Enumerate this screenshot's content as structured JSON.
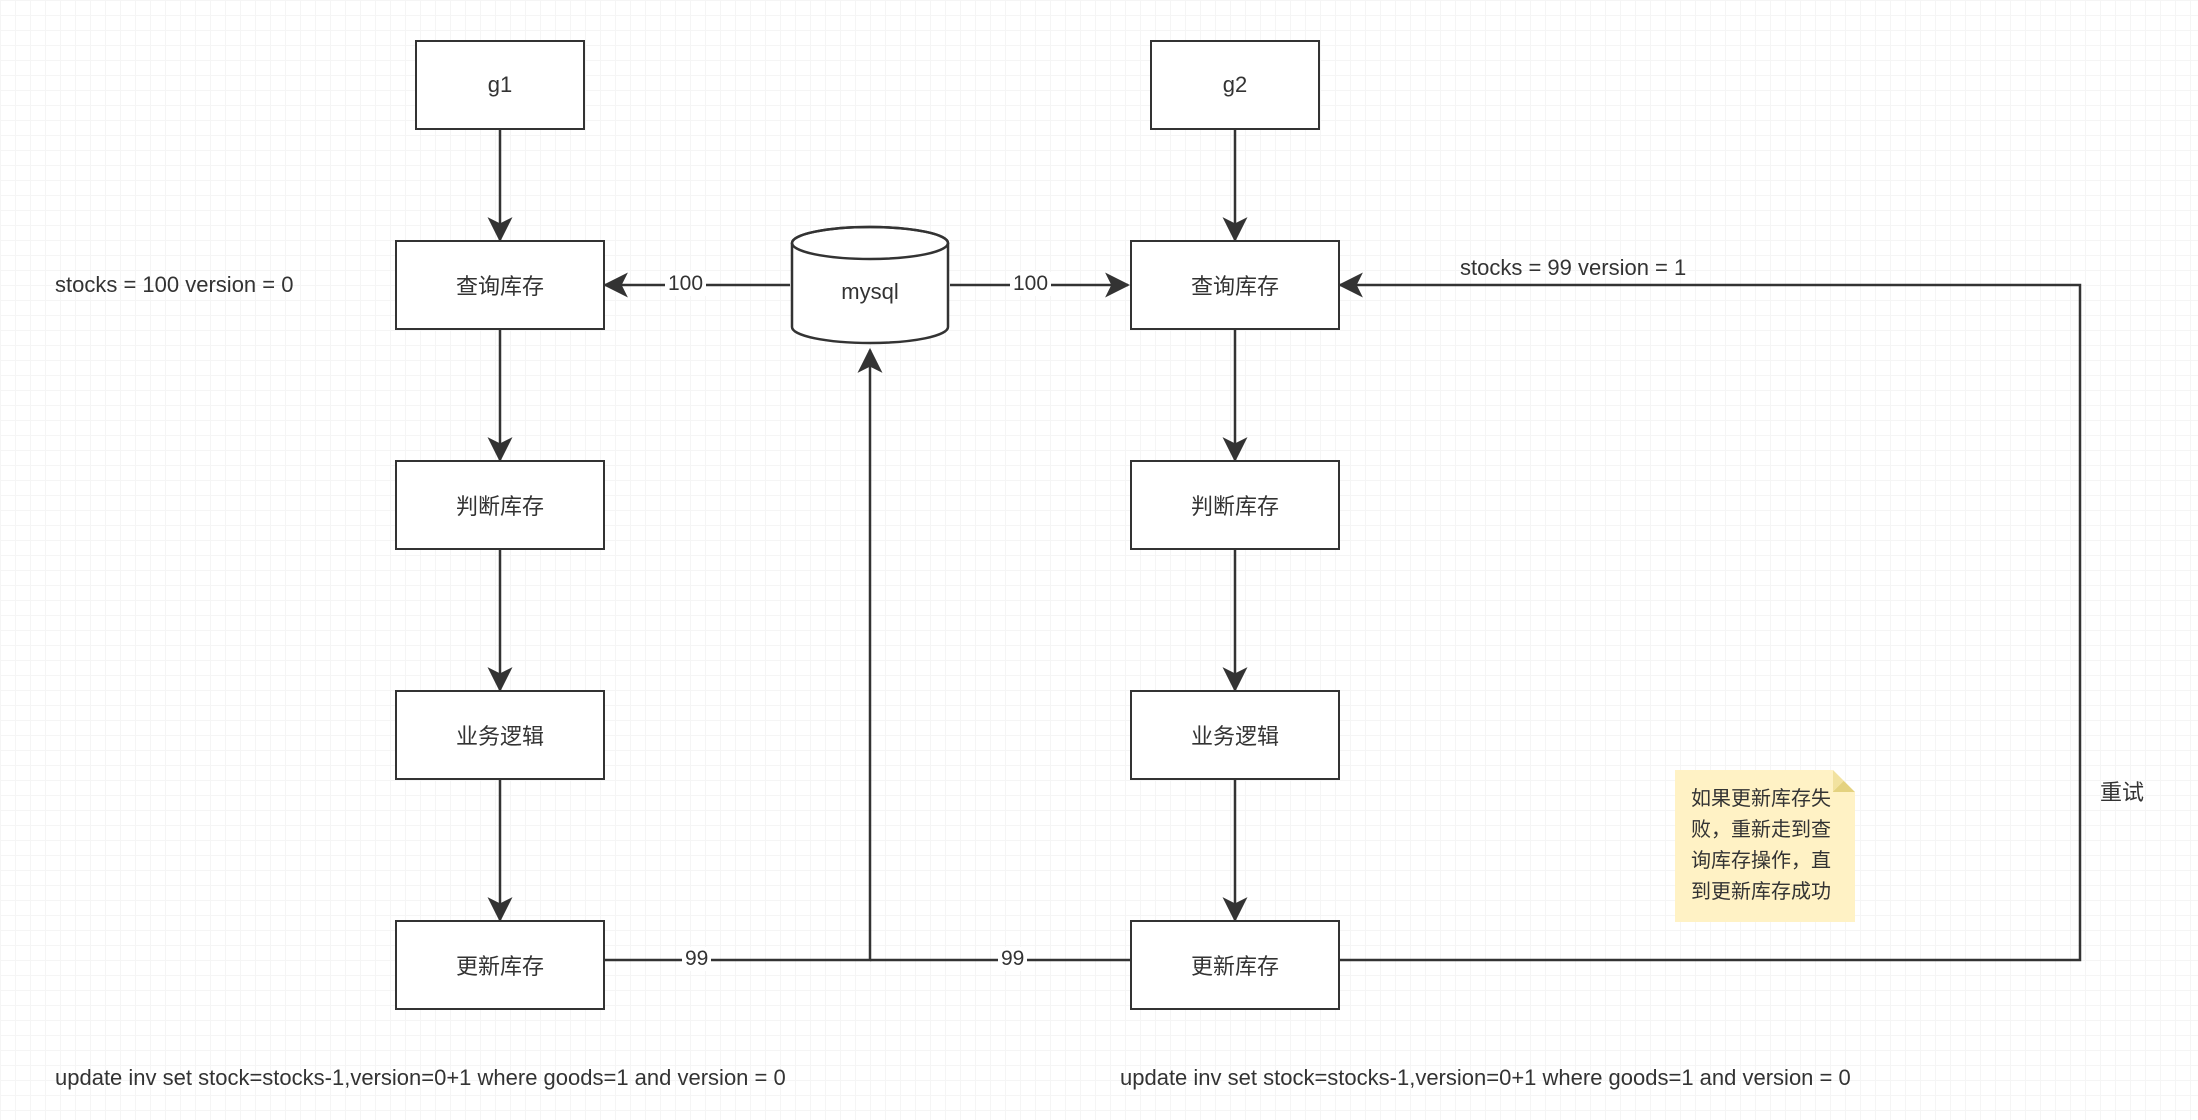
{
  "nodes": {
    "g1": "g1",
    "g2": "g2",
    "mysql": "mysql",
    "query_stock_l": "查询库存",
    "query_stock_r": "查询库存",
    "judge_stock_l": "判断库存",
    "judge_stock_r": "判断库存",
    "biz_logic_l": "业务逻辑",
    "biz_logic_r": "业务逻辑",
    "update_stock_l": "更新库存",
    "update_stock_r": "更新库存"
  },
  "labels": {
    "state_l": "stocks = 100 version = 0",
    "state_r": "stocks = 99 version = 1",
    "sql_l": "update inv set stock=stocks-1,version=0+1 where goods=1 and version = 0",
    "sql_r": "update inv set stock=stocks-1,version=0+1 where goods=1 and version = 0",
    "retry": "重试"
  },
  "edge_labels": {
    "m_to_l": "100",
    "m_to_r": "100",
    "l_to_m": "99",
    "r_to_m": "99"
  },
  "note": "如果更新库存失败，重新走到查询库存操作，直到更新库存成功"
}
